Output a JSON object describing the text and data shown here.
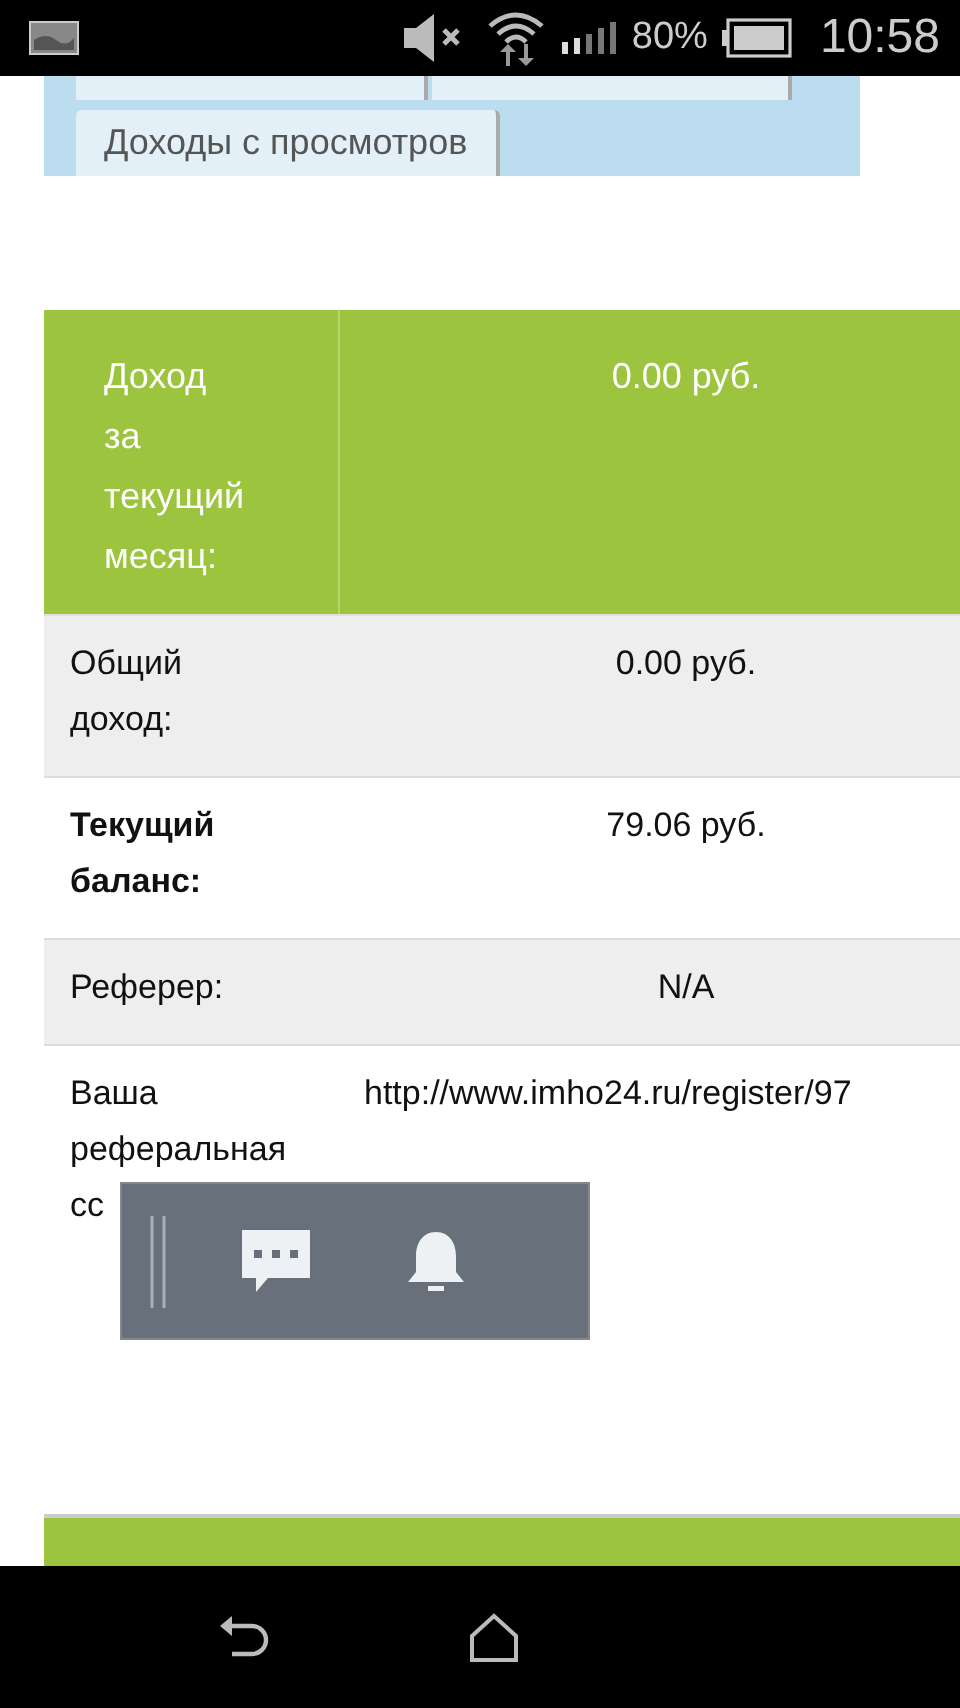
{
  "status_bar": {
    "battery": "80%",
    "time": "10:58"
  },
  "tabs": [
    {
      "label": "Доходы с просмотров"
    }
  ],
  "table": {
    "rows": [
      {
        "kind": "header",
        "label": "Доход за текущий месяц:",
        "value": "0.00 руб."
      },
      {
        "kind": "plain",
        "label": "Общий доход:",
        "value": "0.00 руб."
      },
      {
        "kind": "bold",
        "label": "Текущий баланс:",
        "value": "79.06 руб."
      },
      {
        "kind": "plain",
        "label": "Реферер:",
        "value": "N/A"
      },
      {
        "kind": "link",
        "label": "Ваша реферальная сс",
        "value": "http://www.imho24.ru/register/97"
      }
    ]
  }
}
